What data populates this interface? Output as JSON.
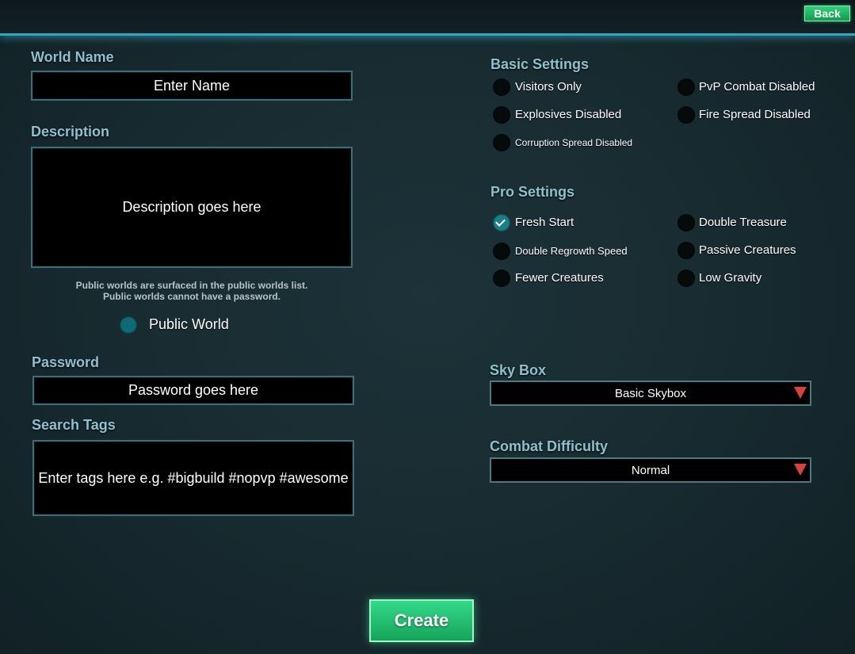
{
  "header": {
    "back_label": "Back"
  },
  "world_name": {
    "label": "World Name",
    "placeholder": "Enter Name"
  },
  "description": {
    "label": "Description",
    "placeholder": "Description goes here"
  },
  "public_note": {
    "line1": "Public worlds are surfaced in the public worlds list.",
    "line2": "Public worlds cannot have a password."
  },
  "public_world": {
    "label": "Public World",
    "checked": false
  },
  "password": {
    "label": "Password",
    "placeholder": "Password goes here"
  },
  "search_tags": {
    "label": "Search Tags",
    "placeholder": "Enter tags here e.g. #bigbuild #nopvp #awesome"
  },
  "basic_settings": {
    "title": "Basic Settings",
    "options": [
      {
        "label": "Visitors Only",
        "checked": false
      },
      {
        "label": "PvP Combat Disabled",
        "checked": false
      },
      {
        "label": "Explosives Disabled",
        "checked": false
      },
      {
        "label": "Fire Spread Disabled",
        "checked": false
      },
      {
        "label": "Corruption Spread Disabled",
        "checked": false
      }
    ]
  },
  "pro_settings": {
    "title": "Pro Settings",
    "options": [
      {
        "label": "Fresh Start",
        "checked": true
      },
      {
        "label": "Double Treasure",
        "checked": false
      },
      {
        "label": "Double Regrowth Speed",
        "checked": false
      },
      {
        "label": "Passive Creatures",
        "checked": false
      },
      {
        "label": "Fewer Creatures",
        "checked": false
      },
      {
        "label": "Low Gravity",
        "checked": false
      }
    ]
  },
  "sky_box": {
    "label": "Sky Box",
    "value": "Basic Skybox"
  },
  "combat_difficulty": {
    "label": "Combat Difficulty",
    "value": "Normal"
  },
  "create_label": "Create",
  "colors": {
    "accent": "#35a6bd",
    "label": "#8ec1cd",
    "button_green": "#1fb868",
    "dropdown_arrow": "#d9423a"
  }
}
